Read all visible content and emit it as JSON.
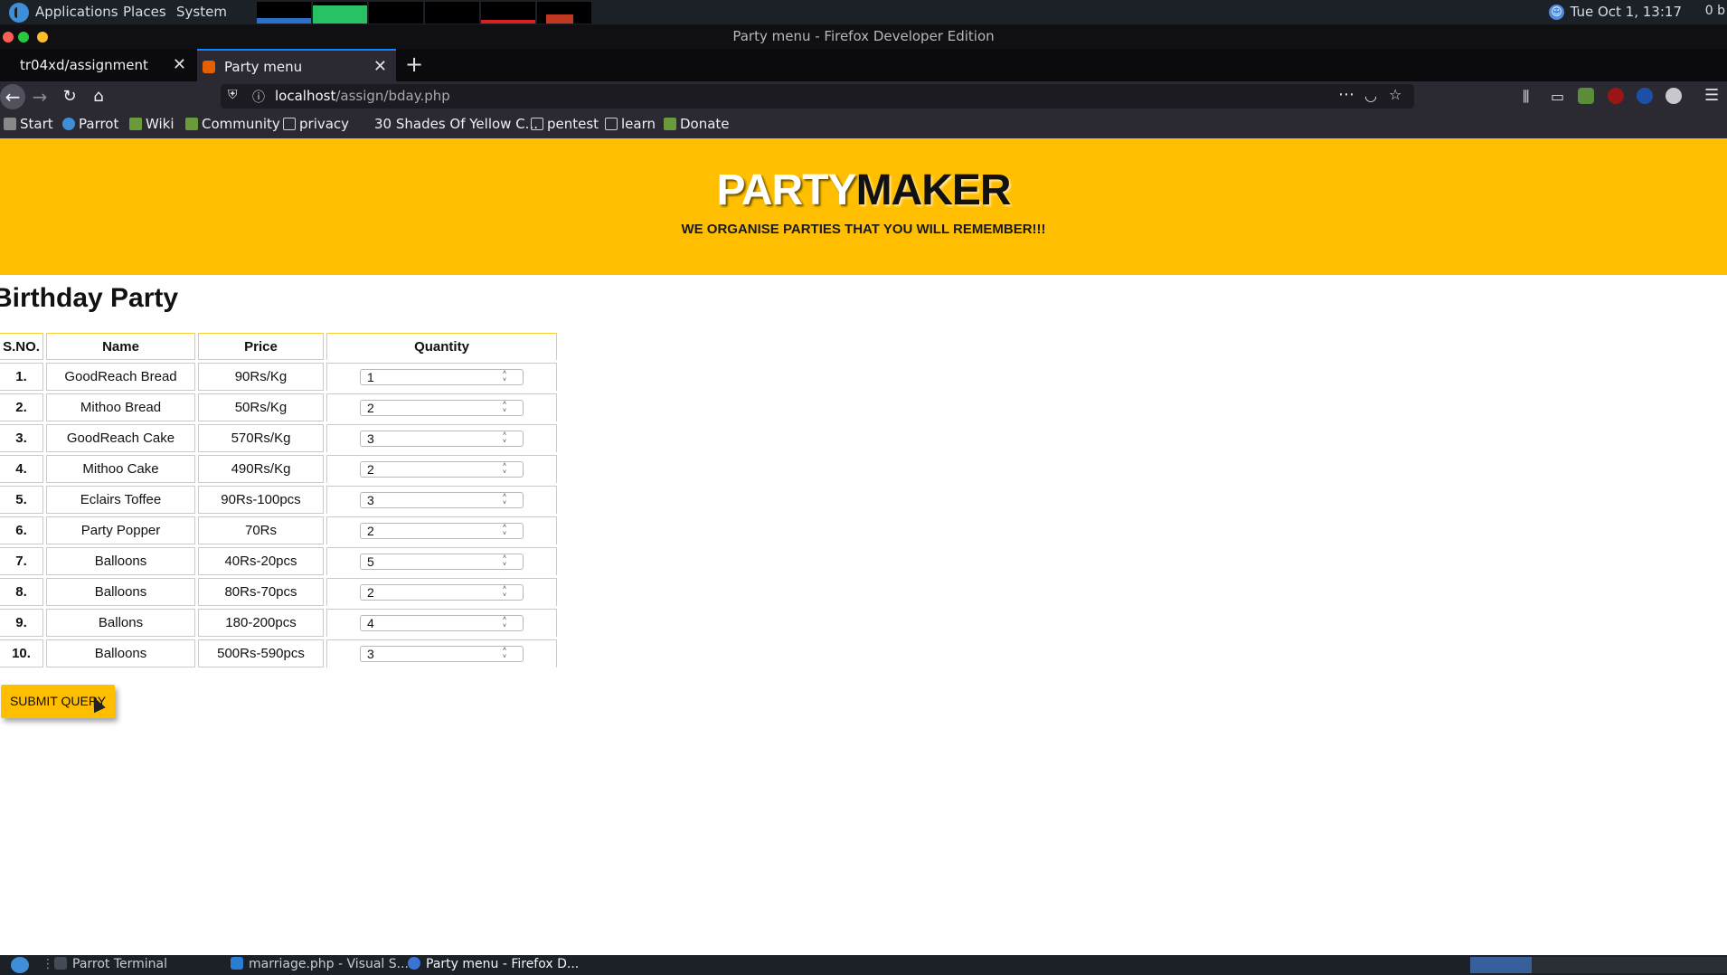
{
  "desktop": {
    "menus": [
      "Applications",
      "Places",
      "System"
    ],
    "clock": "Tue Oct 1, 13:17",
    "net_label": "0 b"
  },
  "window": {
    "title": "Party menu - Firefox Developer Edition"
  },
  "tabs": [
    {
      "label": "tr04xd/assignment"
    },
    {
      "label": "Party menu"
    }
  ],
  "address": {
    "host": "localhost",
    "path": "/assign/bday.php"
  },
  "bookmarks": [
    "Start",
    "Parrot",
    "Wiki",
    "Community",
    "privacy",
    "30 Shades Of Yellow C...",
    "pentest",
    "learn",
    "Donate"
  ],
  "hero": {
    "brand_part1": "PARTY",
    "brand_part2": "MAKER",
    "tagline": "WE ORGANISE PARTIES THAT YOU WILL REMEMBER!!!"
  },
  "page": {
    "title": "Birthday Party",
    "headers": {
      "sno": "S.NO.",
      "name": "Name",
      "price": "Price",
      "qty": "Quantity"
    },
    "rows": [
      {
        "sno": "1.",
        "name": "GoodReach Bread",
        "price": "90Rs/Kg",
        "qty": "1"
      },
      {
        "sno": "2.",
        "name": "Mithoo Bread",
        "price": "50Rs/Kg",
        "qty": "2"
      },
      {
        "sno": "3.",
        "name": "GoodReach Cake",
        "price": "570Rs/Kg",
        "qty": "3"
      },
      {
        "sno": "4.",
        "name": "Mithoo Cake",
        "price": "490Rs/Kg",
        "qty": "2"
      },
      {
        "sno": "5.",
        "name": "Eclairs Toffee",
        "price": "90Rs-100pcs",
        "qty": "3"
      },
      {
        "sno": "6.",
        "name": "Party Popper",
        "price": "70Rs",
        "qty": "2"
      },
      {
        "sno": "7.",
        "name": "Balloons",
        "price": "40Rs-20pcs",
        "qty": "5"
      },
      {
        "sno": "8.",
        "name": "Balloons",
        "price": "80Rs-70pcs",
        "qty": "2"
      },
      {
        "sno": "9.",
        "name": "Ballons",
        "price": "180-200pcs",
        "qty": "4"
      },
      {
        "sno": "10.",
        "name": "Balloons",
        "price": "500Rs-590pcs",
        "qty": "3"
      }
    ],
    "submit_label": "SUBMIT QUERY"
  },
  "taskbar": [
    {
      "label": "Parrot Terminal"
    },
    {
      "label": "marriage.php - Visual S..."
    },
    {
      "label": "Party menu - Firefox D..."
    }
  ],
  "colors": {
    "accent": "#ffbf00",
    "table_border": "#ffcc33"
  }
}
